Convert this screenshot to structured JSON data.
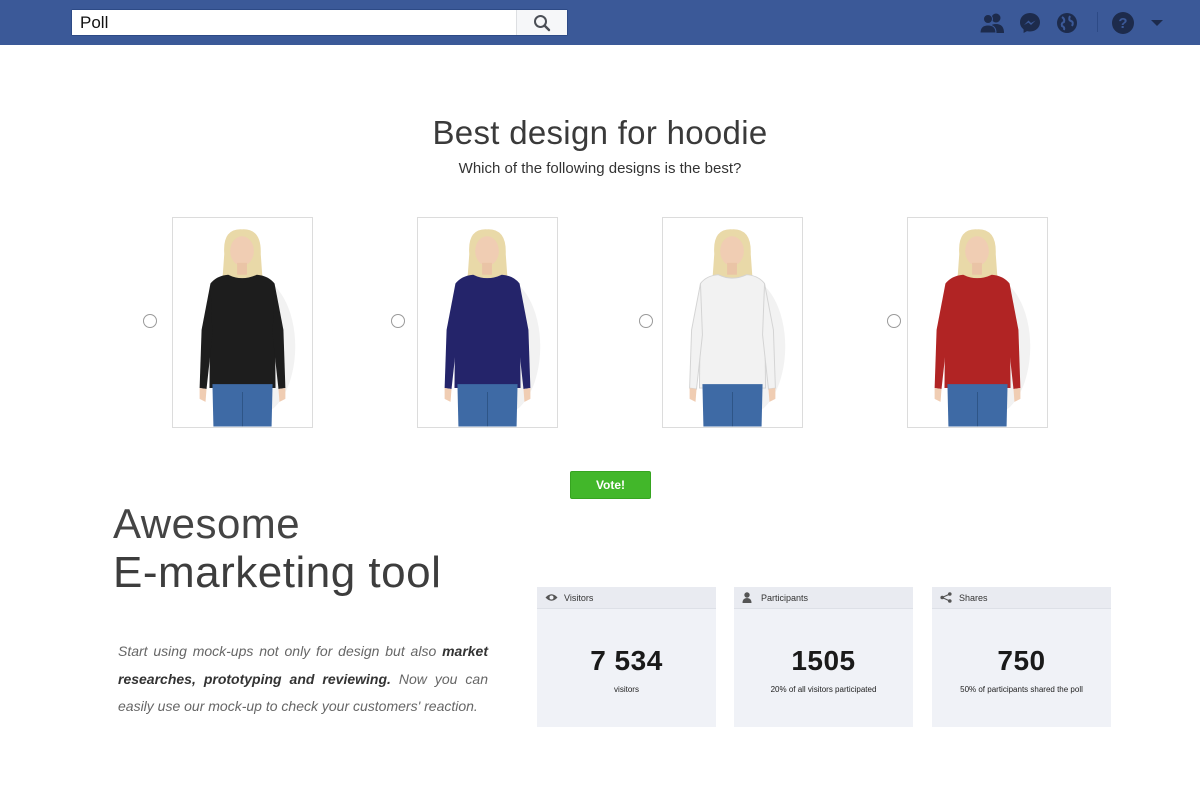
{
  "topbar": {
    "search": {
      "value": "Poll",
      "icon": "search-icon"
    },
    "icons": [
      "friends-icon",
      "messenger-icon",
      "globe-icon",
      "help-icon",
      "caret-down-icon"
    ],
    "color": "#3b5998"
  },
  "poll": {
    "title": "Best design for hoodie",
    "subtitle": "Which of the following designs is the best?",
    "options": [
      {
        "shirt_color": "#1d1d1d"
      },
      {
        "shirt_color": "#24246a"
      },
      {
        "shirt_color": "#f2f2f2"
      },
      {
        "shirt_color": "#b12424"
      }
    ],
    "vote_label": "Vote!"
  },
  "marketing": {
    "line1": "Awesome",
    "line2": "E-marketing tool",
    "blurb_pre": "Start using mock-ups not only for design but also ",
    "blurb_bold": "market researches, prototyping and reviewing.",
    "blurb_post": " Now you can easily use our mock-up to check your customers' reaction."
  },
  "stats": [
    {
      "label": "Visitors",
      "icon": "eye-icon",
      "value": "7 534",
      "caption": "visitors"
    },
    {
      "label": "Participants",
      "icon": "user-icon",
      "value": "1505",
      "caption": "20% of all visitors participated"
    },
    {
      "label": "Shares",
      "icon": "share-icon",
      "value": "750",
      "caption": "50% of participants shared the poll"
    }
  ]
}
